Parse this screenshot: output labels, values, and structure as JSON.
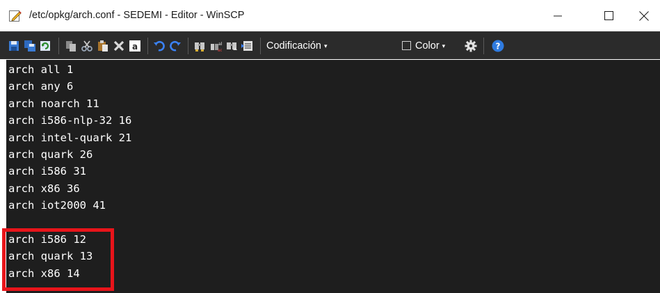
{
  "window": {
    "title": "/etc/opkg/arch.conf - SEDEMI - Editor - WinSCP",
    "controls": [
      "minimize",
      "maximize",
      "close"
    ]
  },
  "toolbar": {
    "icons": [
      "save-icon",
      "save-all-icon",
      "reload-icon",
      "copy-icon",
      "cut-icon",
      "paste-icon",
      "delete-icon",
      "select-all-icon",
      "undo-icon",
      "redo-icon",
      "find-icon",
      "replace-icon",
      "find-next-icon",
      "goto-line-icon",
      "settings-icon",
      "help-icon"
    ],
    "encoding_label": "Codificación",
    "color_label": "Color",
    "caret": "▾"
  },
  "editor": {
    "lines": [
      "arch all 1",
      "arch any 6",
      "arch noarch 11",
      "arch i586-nlp-32 16",
      "arch intel-quark 21",
      "arch quark 26",
      "arch i586 31",
      "arch x86 36",
      "arch iot2000 41",
      "",
      "arch i586 12",
      "arch quark 13",
      "arch x86 14"
    ],
    "highlight_color": "#e8141a",
    "background": "#1e1e1e",
    "text_color": "#ffffff"
  }
}
